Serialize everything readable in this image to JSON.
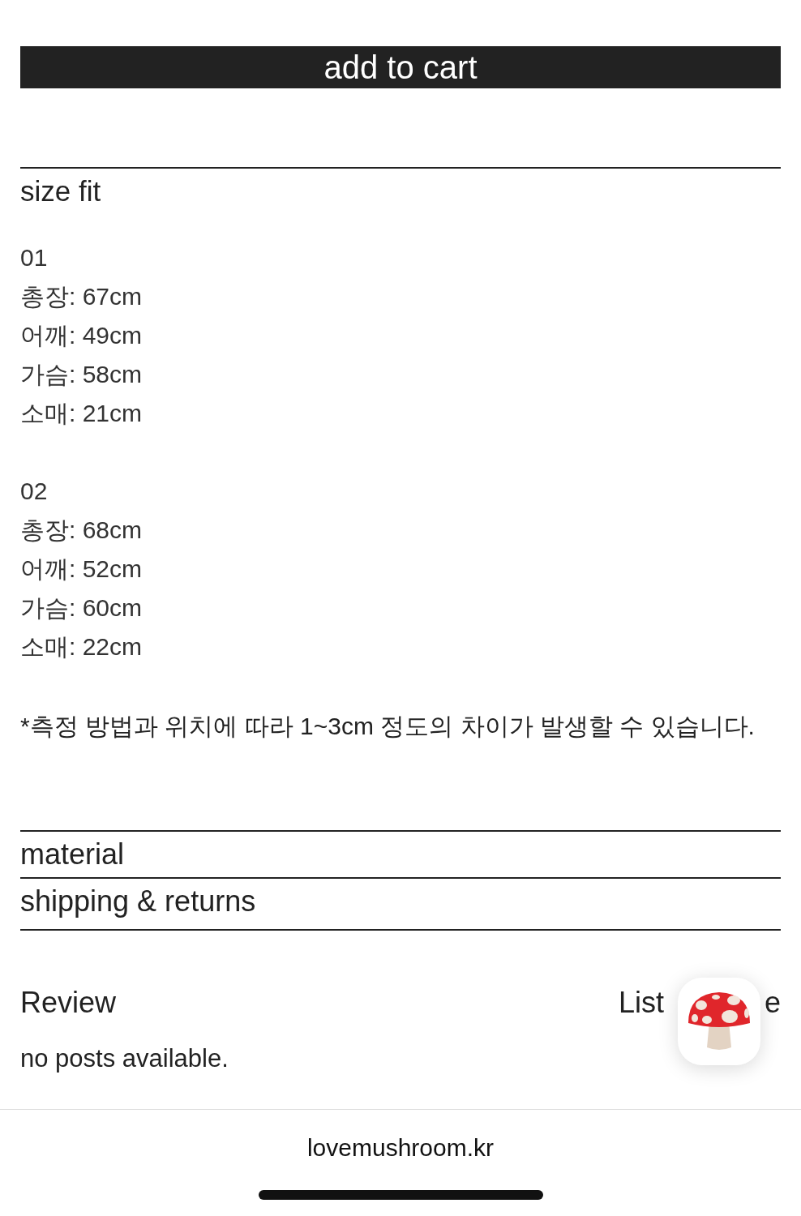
{
  "cart_button": {
    "label": "add to cart"
  },
  "size_fit": {
    "title": "size fit",
    "sizes": [
      {
        "label": "01",
        "measurements": [
          "총장: 67cm",
          "어깨: 49cm",
          "가슴: 58cm",
          "소매: 21cm"
        ]
      },
      {
        "label": "02",
        "measurements": [
          "총장: 68cm",
          "어깨: 52cm",
          "가슴: 60cm",
          "소매: 22cm"
        ]
      }
    ],
    "note": "*측정 방법과 위치에 따라 1~3cm 정도의 차이가 발생할 수 있습니다."
  },
  "sections": [
    "material",
    "shipping & returns"
  ],
  "review": {
    "title": "Review",
    "links": [
      "List",
      "e"
    ],
    "empty": "no posts available."
  },
  "footer": {
    "domain": "lovemushroom.kr"
  }
}
